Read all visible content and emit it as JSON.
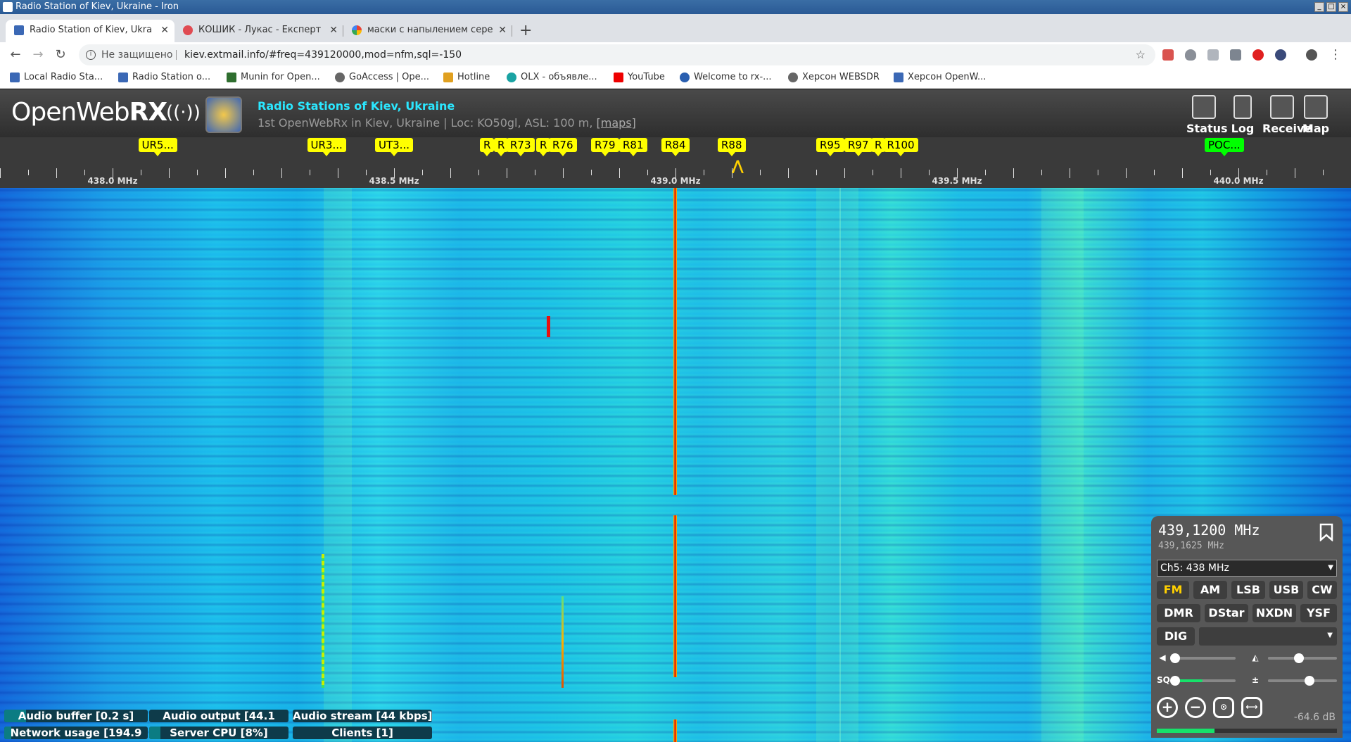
{
  "window": {
    "title": "Radio Station of Kiev, Ukraine - Iron"
  },
  "tabs": [
    {
      "label": "Radio Station of Kiev, Ukra",
      "active": true
    },
    {
      "label": "КОШИК - Лукас - Експерт",
      "active": false
    },
    {
      "label": "маски с напылением сере",
      "active": false
    }
  ],
  "address": {
    "security": "Не защищено",
    "url": "kiev.extmail.info/#freq=439120000,mod=nfm,sql=-150"
  },
  "bookmarks": [
    "Local Radio Sta...",
    "Radio Station o...",
    "Munin for Open...",
    "GoAccess | Ope...",
    "Hotline",
    "OLX - объявле...",
    "YouTube",
    "Welcome to rx-...",
    "Херсон WEBSDR",
    "Херсон OpenW..."
  ],
  "header": {
    "logo_plain": "OpenWeb",
    "logo_bold": "RX",
    "receiver_title": "Radio Stations of Kiev, Ukraine",
    "receiver_desc": "1st OpenWebRx in Kiev, Ukraine | Loc: KO50gl, ASL: 100 m,",
    "maps_link": "[maps]",
    "buttons": [
      "Status",
      "Log",
      "Receive",
      "Map"
    ]
  },
  "freq_bookmarks": [
    {
      "label": "UR5...",
      "mhz": 438.08
    },
    {
      "label": "UR3...",
      "mhz": 438.38
    },
    {
      "label": "UT3...",
      "mhz": 438.5
    },
    {
      "label": "R",
      "mhz": 438.665
    },
    {
      "label": "R",
      "mhz": 438.69
    },
    {
      "label": "R73",
      "mhz": 438.725
    },
    {
      "label": "R",
      "mhz": 438.765
    },
    {
      "label": "R76",
      "mhz": 438.8
    },
    {
      "label": "R79",
      "mhz": 438.875
    },
    {
      "label": "R81",
      "mhz": 438.925
    },
    {
      "label": "R84",
      "mhz": 439.0
    },
    {
      "label": "R88",
      "mhz": 439.1
    },
    {
      "label": "R95",
      "mhz": 439.275
    },
    {
      "label": "R97",
      "mhz": 439.325
    },
    {
      "label": "R",
      "mhz": 439.36
    },
    {
      "label": "R100",
      "mhz": 439.4
    },
    {
      "label": "POC...",
      "mhz": 439.975,
      "green": true
    }
  ],
  "scale": {
    "labels": [
      "438.0 MHz",
      "438.5 MHz",
      "439.0 MHz",
      "439.5 MHz",
      "440.0 MHz"
    ],
    "start_mhz": 437.8,
    "end_mhz": 440.2
  },
  "status": {
    "audio_buffer": "Audio buffer [0.2 s]",
    "audio_output": "Audio output [44.1",
    "audio_stream": "Audio stream [44 kbps]",
    "network": "Network usage [194.9",
    "server_cpu": "Server CPU [8%]",
    "clients": "Clients [1]",
    "audio_buffer_level": 0.15,
    "audio_output_level": 0.0,
    "audio_stream_level": 0.0,
    "network_level": 0.05,
    "server_cpu_level": 0.08,
    "clients_level": 0.0
  },
  "receiver": {
    "frequency": "439,1200 MHz",
    "frequency_secondary": "439,1625 MHz",
    "profile": "Ch5: 438 MHz",
    "modes_row1": [
      "FM",
      "AM",
      "LSB",
      "USB",
      "CW"
    ],
    "modes_row2": [
      "DMR",
      "DStar",
      "NXDN",
      "YSF"
    ],
    "dig_label": "DIG",
    "selected_mode": "FM",
    "volume_level": 0.0,
    "squelch_level": 0.0,
    "nr_level": 0.45,
    "agc_level": 0.6,
    "smeter_db": "-64.6 dB",
    "smeter_level": 0.32
  }
}
